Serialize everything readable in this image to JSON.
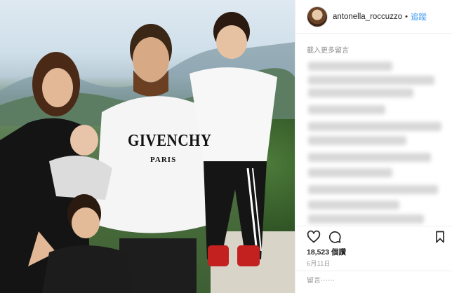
{
  "photo": {
    "shirt_brand": "GIVENCHY",
    "shirt_city": "PARIS"
  },
  "header": {
    "username": "antonella_roccuzzo",
    "separator": "•",
    "follow_label": "追蹤"
  },
  "comments": {
    "load_more": "載入更多留言"
  },
  "actions": {
    "like_icon": "heart-icon",
    "comment_icon": "comment-icon",
    "save_icon": "bookmark-icon"
  },
  "stats": {
    "likes_count": "18,523",
    "likes_unit": "個讚",
    "date": "6月11日"
  },
  "comment_box": {
    "placeholder": "留言⋯⋯"
  },
  "colors": {
    "link": "#3897f0",
    "text": "#262626",
    "muted": "#8e8e8e",
    "border": "#efefef"
  }
}
